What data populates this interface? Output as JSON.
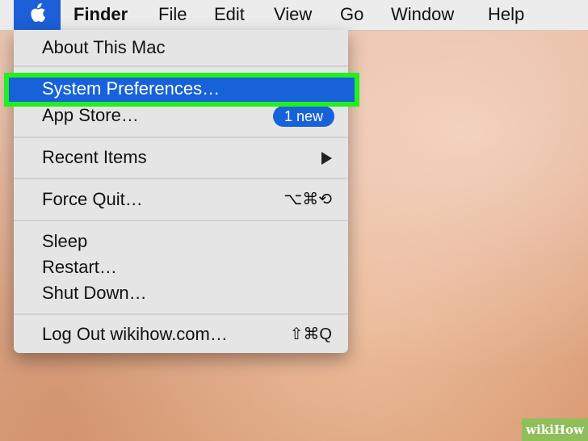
{
  "menubar": {
    "apple_icon": "apple-logo-icon",
    "items": [
      "Finder",
      "File",
      "Edit",
      "View",
      "Go",
      "Window",
      "Help"
    ],
    "accent_color": "#1c5fd8"
  },
  "apple_menu": {
    "about": "About This Mac",
    "system_preferences": "System Preferences…",
    "app_store": "App Store…",
    "app_store_badge": "1 new",
    "recent_items": "Recent Items",
    "force_quit": "Force Quit…",
    "force_quit_shortcut": "⌥⌘⟲",
    "sleep": "Sleep",
    "restart": "Restart…",
    "shut_down": "Shut Down…",
    "log_out": "Log Out wikihow.com…",
    "log_out_shortcut": "⇧⌘Q",
    "highlight_color": "#22ee22",
    "selected_color": "#1762d9"
  },
  "watermark": {
    "text": "wikiHow"
  }
}
